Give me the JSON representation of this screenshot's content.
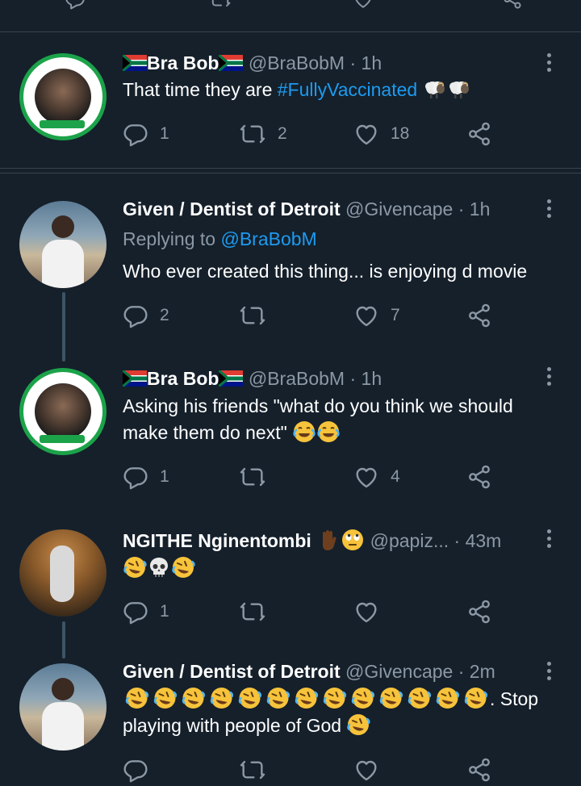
{
  "tweets": [
    {
      "name": "Bra Bob",
      "handle": "@BraBobM",
      "dot": "·",
      "time": "1h",
      "text_pre": "That time they are ",
      "hashtag": "#FullyVaccinated",
      "replies": "1",
      "retweets": "2",
      "likes": "18"
    },
    {
      "name": "Given / Dentist of Detroit",
      "handle": "@Givencape",
      "dot": "·",
      "time": "1h",
      "replying_label": "Replying to ",
      "replying_to": "@BraBobM",
      "text": "Who ever created this thing... is enjoying d movie",
      "replies": "2",
      "retweets": "",
      "likes": "7"
    },
    {
      "name": "Bra Bob",
      "handle": "@BraBobM",
      "dot": "·",
      "time": "1h",
      "text_line1": "Asking his friends \"what do you think we should",
      "text_line2": "make them do next\"",
      "replies": "1",
      "retweets": "",
      "likes": "4"
    },
    {
      "name": "NGITHE Nginentombi",
      "handle": "@papiz...",
      "dot": "·",
      "time": "43m",
      "replies": "1",
      "retweets": "",
      "likes": ""
    },
    {
      "name": "Given / Dentist of Detroit",
      "handle": "@Givencape",
      "dot": "·",
      "time": "2m",
      "text_line1_suffix": ".  Stop",
      "text_line2": "playing with people of God"
    }
  ],
  "colors": {
    "background": "#15202b",
    "secondary_text": "#8b98a5",
    "link": "#1d9bf0",
    "divider": "#38444d"
  },
  "icons": [
    "reply-icon",
    "retweet-icon",
    "like-icon",
    "share-icon",
    "more-icon",
    "sa-flag-icon",
    "sheep-emoji",
    "rofl-emoji",
    "skull-emoji",
    "joy-emoji",
    "raised-hand-emoji",
    "eye-roll-emoji"
  ]
}
